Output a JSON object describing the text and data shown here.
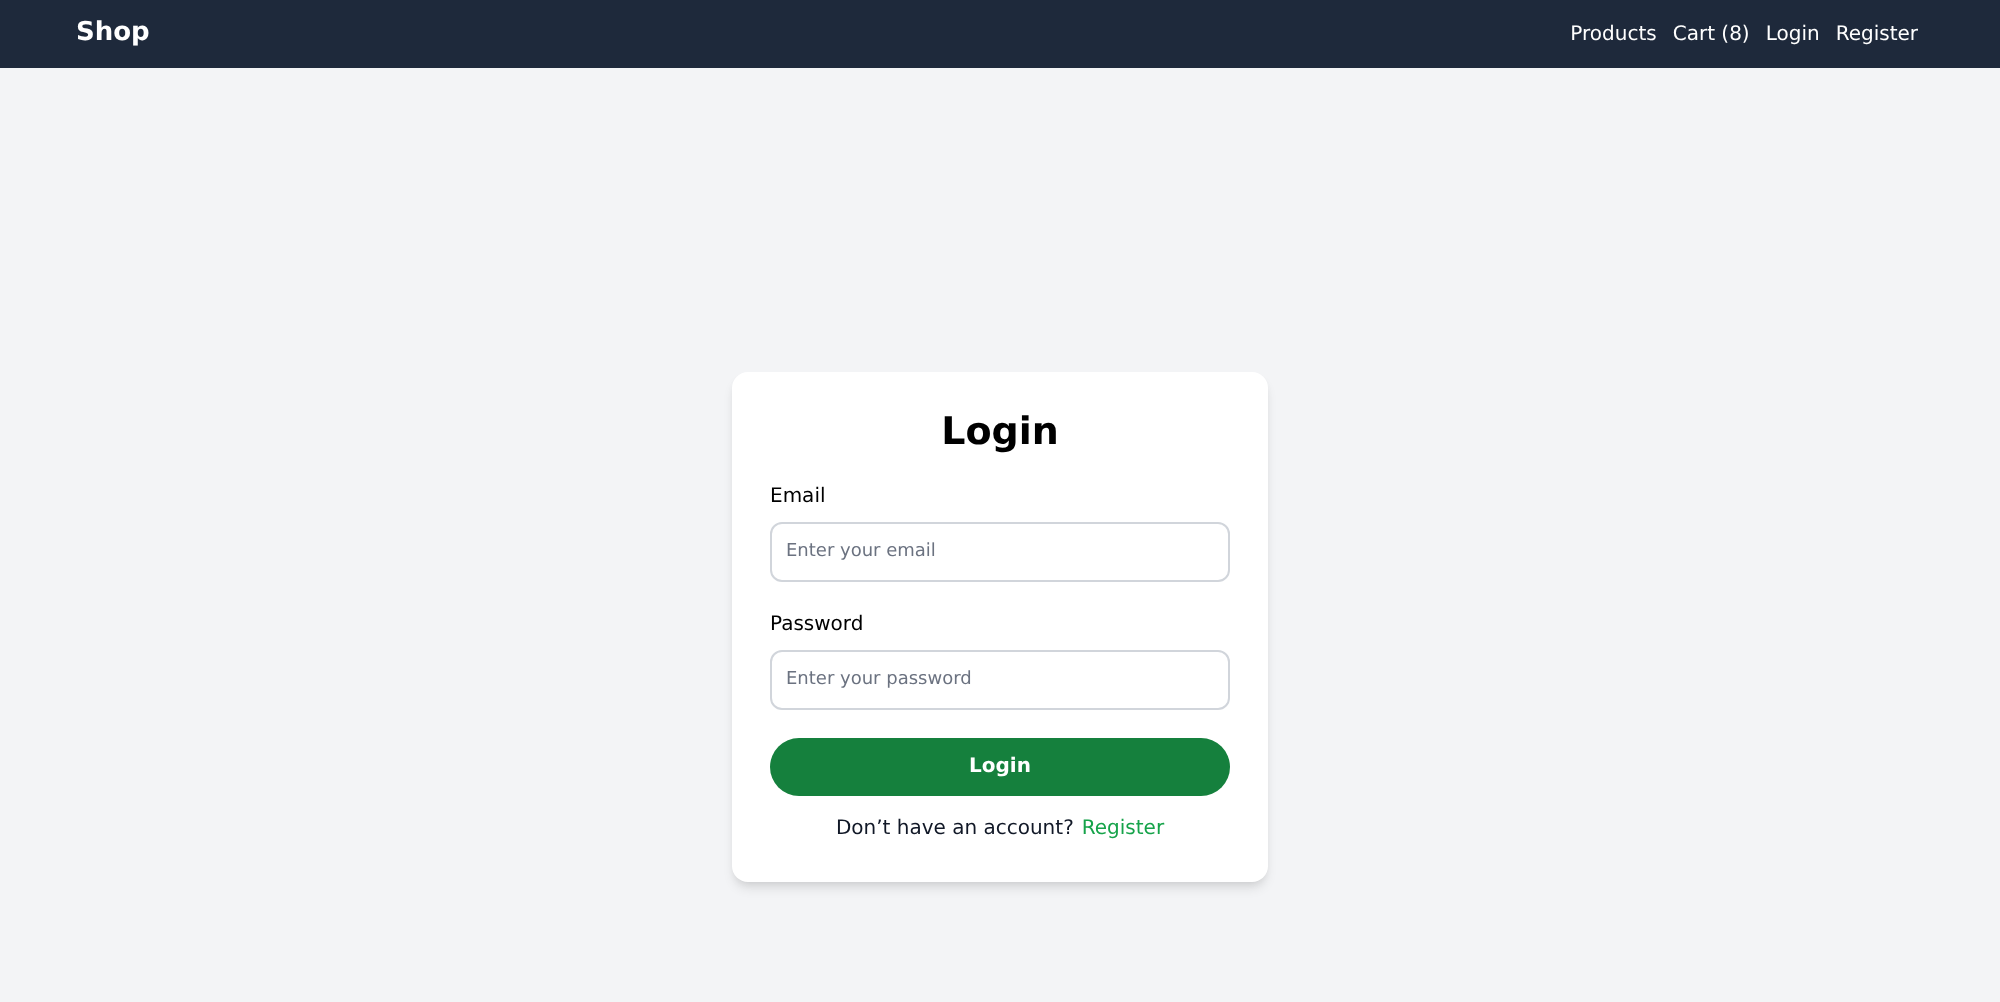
{
  "navbar": {
    "brand": "Shop",
    "links": [
      "Products",
      "Cart (8)",
      "Login",
      "Register"
    ]
  },
  "login_form": {
    "title": "Login",
    "fields": [
      {
        "label": "Email",
        "placeholder": "Enter your email"
      },
      {
        "label": "Password",
        "placeholder": "Enter your password"
      }
    ],
    "submit": "Login",
    "prompt": "Don’t have an account?",
    "prompt_link": "Register"
  }
}
